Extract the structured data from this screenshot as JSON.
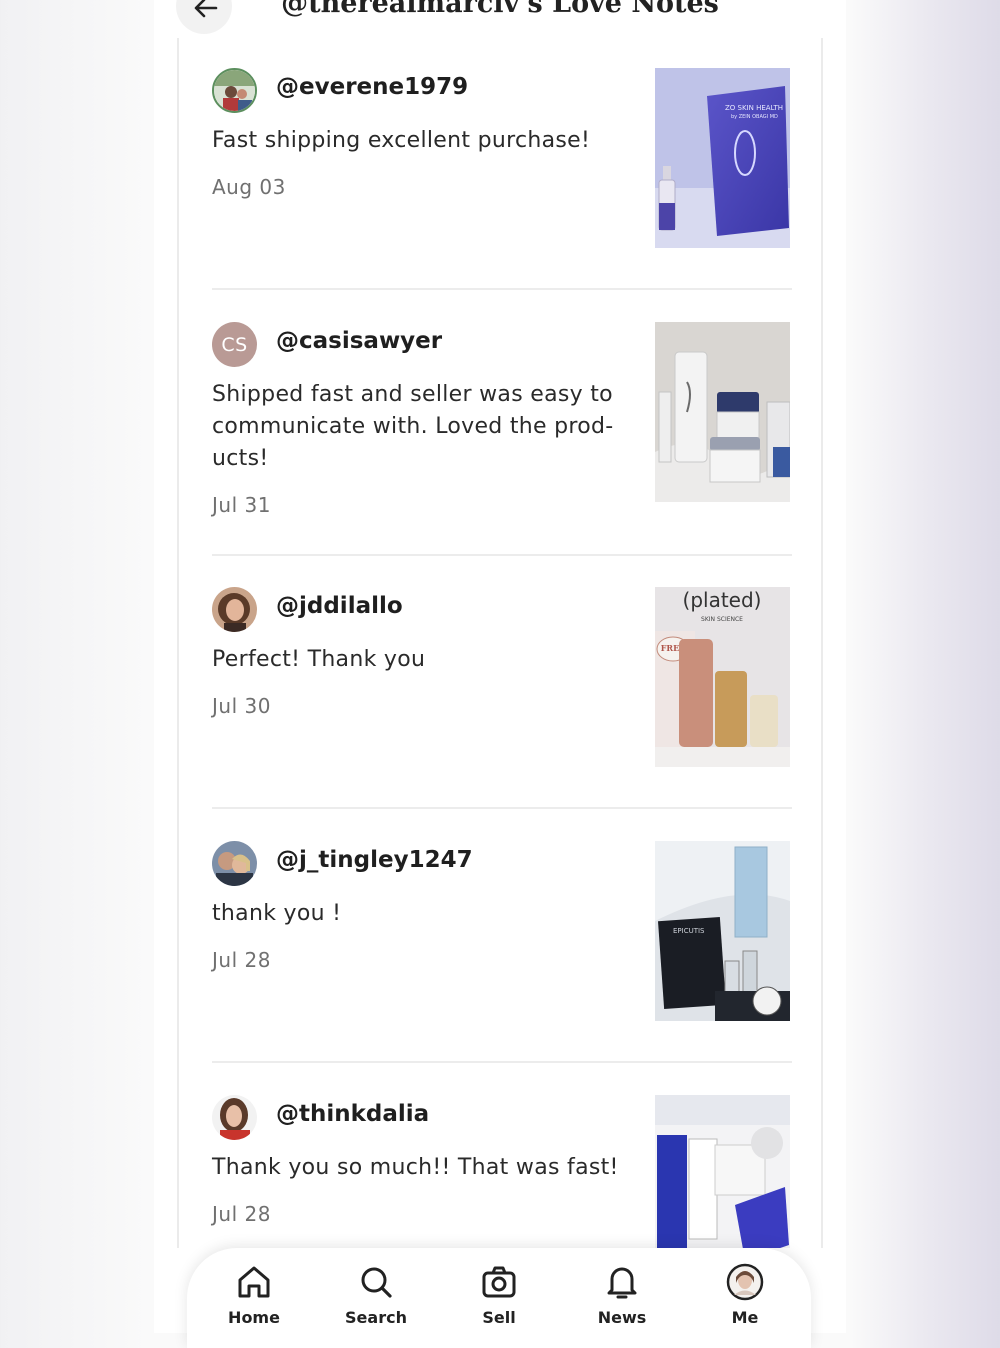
{
  "header": {
    "title": "@therealmarciv's Love Notes"
  },
  "reviews": [
    {
      "username": "@everene1979",
      "text": "Fast shipping excellent purchase!",
      "date": "Aug 03",
      "avatar": "photo"
    },
    {
      "username": "@casisawyer",
      "text": "Shipped fast and seller was easy to communicate with. Loved the prod-ucts!",
      "date": "Jul 31",
      "avatar_initials": "CS"
    },
    {
      "username": "@jddilallo",
      "text": "Perfect! Thank you",
      "date": "Jul 30",
      "avatar": "photo"
    },
    {
      "username": "@j_tingley1247",
      "text": "thank you !",
      "date": "Jul 28",
      "avatar": "photo"
    },
    {
      "username": "@thinkdalia",
      "text": "Thank you so much!! That was fast!",
      "date": "Jul 28",
      "avatar": "photo"
    }
  ],
  "thumbs": {
    "zo_brand": "ZO SKIN HEALTH",
    "zo_sub": "by ZEIN OBAGI MD",
    "plated_brand": "(plated)",
    "plated_sub": "SKIN SCIENCE",
    "plated_free": "FREE",
    "epicutis_brand": "EPICUTIS"
  },
  "tabbar": {
    "items": [
      {
        "label": "Home",
        "icon": "home-icon"
      },
      {
        "label": "Search",
        "icon": "search-icon"
      },
      {
        "label": "Sell",
        "icon": "camera-icon"
      },
      {
        "label": "News",
        "icon": "bell-icon"
      },
      {
        "label": "Me",
        "icon": "avatar-icon"
      }
    ]
  },
  "colors": {
    "accent_avatar": "#b99a95",
    "text": "#1f1f1f",
    "muted": "#707070"
  }
}
